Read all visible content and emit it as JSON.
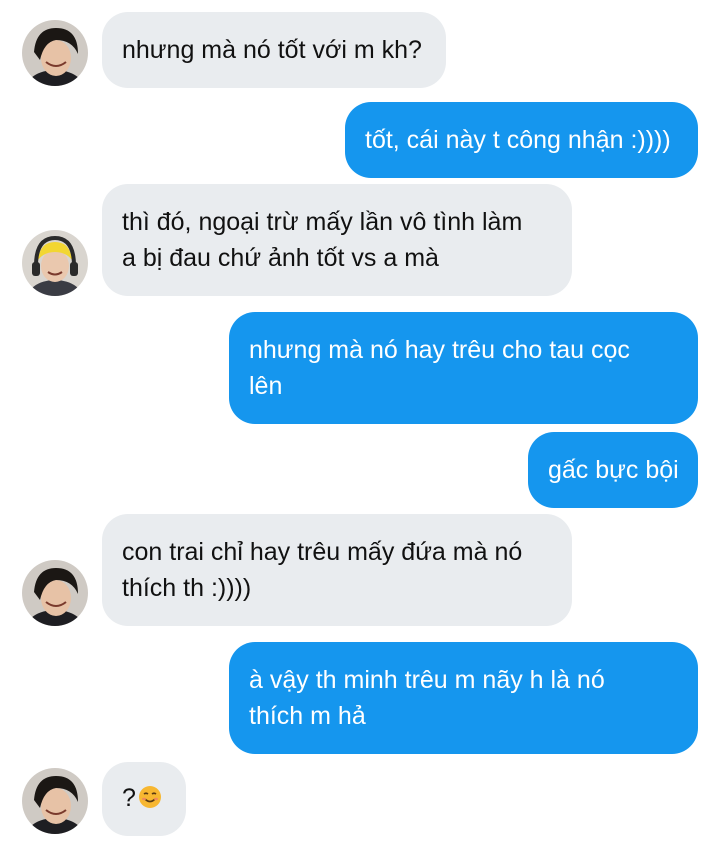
{
  "messages": [
    {
      "side": "in",
      "lines": [
        "nhưng mà nó tốt với m kh?"
      ],
      "avatar": "avatar-boy-icon"
    },
    {
      "side": "out",
      "lines": [
        "tốt, cái này t công nhận :))))"
      ]
    },
    {
      "side": "in",
      "lines": [
        "thì đó, ngoại trừ mấy lần vô tình làm",
        "a bị đau chứ ảnh tốt vs a mà"
      ],
      "avatar": "avatar-headphones-icon"
    },
    {
      "side": "out",
      "lines": [
        "nhưng mà nó hay trêu cho tau cọc",
        "lên"
      ]
    },
    {
      "side": "out",
      "lines": [
        "gấc bực bội"
      ]
    },
    {
      "side": "in",
      "lines": [
        "con trai chỉ hay trêu mấy đứa mà nó",
        "thích th :))))"
      ],
      "avatar": "avatar-boy-icon"
    },
    {
      "side": "out",
      "lines": [
        "à vậy th minh trêu m nãy h là nó",
        "thích m hả"
      ]
    },
    {
      "side": "in",
      "lines": [
        "?"
      ],
      "emoji": "smiling-face-emoji-icon",
      "avatar": "avatar-boy-icon"
    }
  ],
  "colors": {
    "incoming_bubble": "#e9ecef",
    "outgoing_bubble": "#1596ee",
    "incoming_text": "#111111",
    "outgoing_text": "#ffffff"
  }
}
